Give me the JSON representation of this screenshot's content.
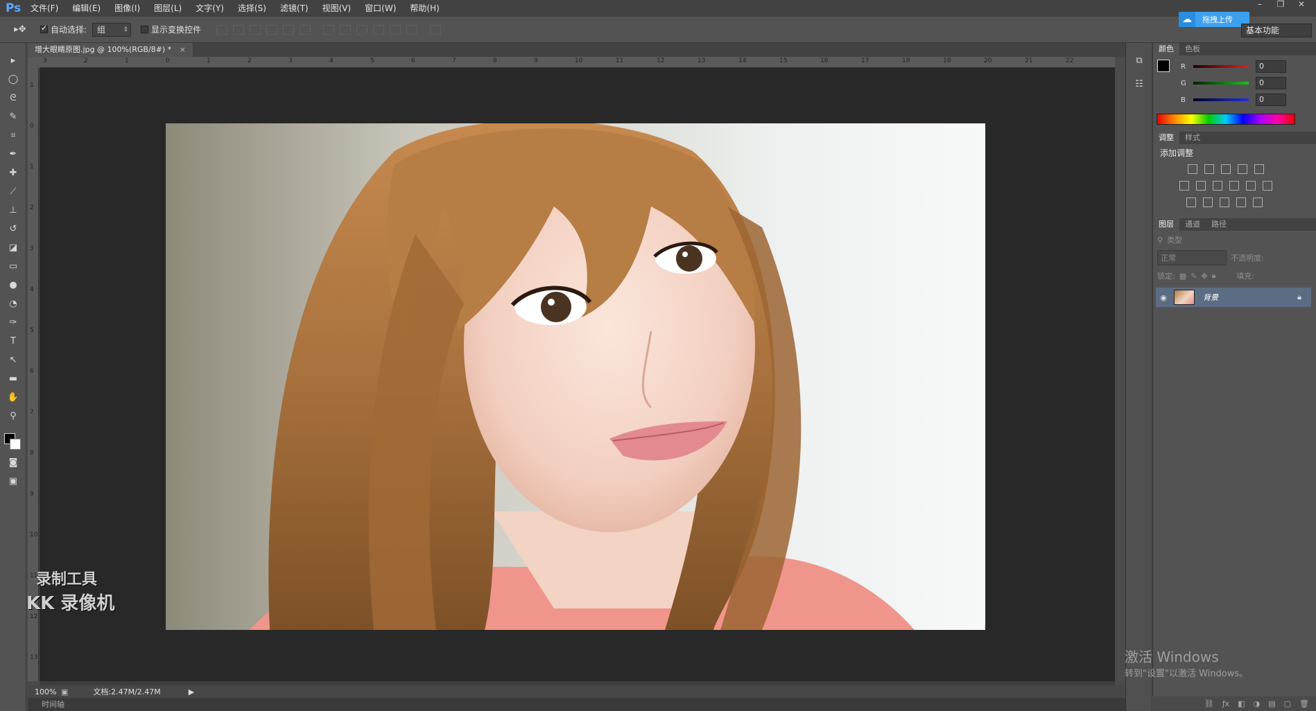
{
  "menubar": {
    "logo": "Ps",
    "items": [
      "文件(F)",
      "编辑(E)",
      "图像(I)",
      "图层(L)",
      "文字(Y)",
      "选择(S)",
      "滤镜(T)",
      "视图(V)",
      "窗口(W)",
      "帮助(H)"
    ],
    "window_controls": [
      "–",
      "❐",
      "✕"
    ]
  },
  "options": {
    "auto_select_label": "自动选择:",
    "auto_select_value": "组",
    "show_transform_label": "显示变换控件",
    "upload_label": "拖拽上传",
    "workspace": "基本功能"
  },
  "document": {
    "tab_title": "增大眼睛原图.jpg @ 100%(RGB/8#) *",
    "ruler_h": [
      "3",
      "2",
      "1",
      "0",
      "1",
      "2",
      "3",
      "4",
      "5",
      "6",
      "7",
      "8",
      "9",
      "10",
      "11",
      "12",
      "13",
      "14",
      "15",
      "16",
      "17",
      "18",
      "19",
      "20",
      "21",
      "22"
    ],
    "ruler_v": [
      "1",
      "0",
      "1",
      "2",
      "3",
      "4",
      "5",
      "6",
      "7",
      "8",
      "9",
      "10",
      "11",
      "12",
      "13"
    ],
    "zoom": "100%",
    "doc_size": "文档:2.47M/2.47M",
    "timeline": "时间轴"
  },
  "watermark": {
    "line1": "录制工具",
    "line2": "KK 录像机"
  },
  "color_panel": {
    "tabs": [
      "颜色",
      "色板"
    ],
    "channels": [
      {
        "label": "R",
        "value": "0",
        "color": "#e02020"
      },
      {
        "label": "G",
        "value": "0",
        "color": "#20c020"
      },
      {
        "label": "B",
        "value": "0",
        "color": "#2030e0"
      }
    ]
  },
  "adjust_panel": {
    "tabs": [
      "调整",
      "样式"
    ],
    "title": "添加调整"
  },
  "layers_panel": {
    "tabs": [
      "图层",
      "通道",
      "路径"
    ],
    "kind_label": "类型",
    "blend_mode": "正常",
    "opacity_label": "不透明度:",
    "lock_label": "锁定:",
    "fill_label": "填充:",
    "layer_name": "背景"
  },
  "activation": {
    "title": "激活 Windows",
    "subtitle": "转到\"设置\"以激活 Windows。"
  }
}
